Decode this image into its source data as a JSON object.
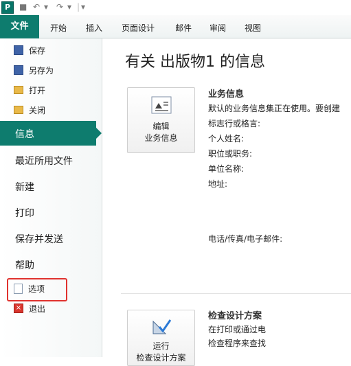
{
  "quick_access": {
    "app_icon": "publisher-app-icon"
  },
  "ribbon": {
    "file_tab": "文件",
    "tabs": [
      "开始",
      "插入",
      "页面设计",
      "邮件",
      "审阅",
      "视图"
    ]
  },
  "sidebar": {
    "small_items_top": [
      {
        "label": "保存",
        "icon": "save-icon"
      },
      {
        "label": "另存为",
        "icon": "save-as-icon"
      },
      {
        "label": "打开",
        "icon": "open-folder-icon"
      },
      {
        "label": "关闭",
        "icon": "close-folder-icon"
      }
    ],
    "selected": "信息",
    "big_items": [
      "最近所用文件",
      "新建",
      "打印",
      "保存并发送",
      "帮助"
    ],
    "small_items_bottom": [
      {
        "label": "选项",
        "icon": "options-icon"
      },
      {
        "label": "退出",
        "icon": "exit-icon"
      }
    ]
  },
  "main": {
    "title": "有关 出版物1 的信息",
    "business_button": {
      "line1": "编辑",
      "line2": "业务信息"
    },
    "business": {
      "title": "业务信息",
      "description": "默认的业务信息集正在使用。要创建",
      "fields": [
        "标志行或格言:",
        "个人姓名:",
        "职位或职务:",
        "单位名称:",
        "地址:"
      ],
      "contact": "电话/传真/电子邮件:"
    },
    "check_button": {
      "line1": "运行",
      "line2": "检查设计方案"
    },
    "check": {
      "title": "检查设计方案",
      "line1": "在打印或通过电",
      "line2": "检查程序来查找"
    }
  },
  "colors": {
    "accent": "#0e7c6e",
    "highlight_box": "#e0322e"
  }
}
